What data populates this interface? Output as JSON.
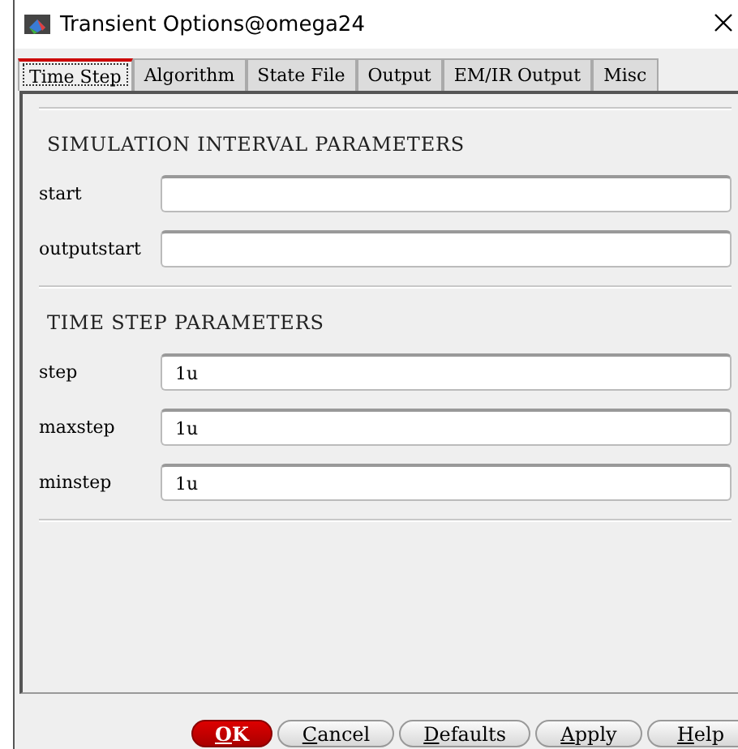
{
  "window": {
    "title": "Transient Options@omega24"
  },
  "tabs": [
    {
      "label": "Time Step",
      "selected": true
    },
    {
      "label": "Algorithm",
      "selected": false
    },
    {
      "label": "State File",
      "selected": false
    },
    {
      "label": "Output",
      "selected": false
    },
    {
      "label": "EM/IR Output",
      "selected": false
    },
    {
      "label": "Misc",
      "selected": false
    }
  ],
  "sections": [
    {
      "heading": "SIMULATION INTERVAL PARAMETERS",
      "fields": [
        {
          "label": "start"
        },
        {
          "label": "outputstart"
        }
      ]
    },
    {
      "heading": "TIME STEP PARAMETERS",
      "fields": [
        {
          "label": "step",
          "value": "1u"
        },
        {
          "label": "maxstep",
          "value": "1u"
        },
        {
          "label": "minstep",
          "value": "1u"
        }
      ]
    }
  ],
  "buttons": [
    {
      "label": "OK",
      "kind": "default"
    },
    {
      "label": "Cancel",
      "kind": "normal"
    },
    {
      "label": "Defaults",
      "kind": "normal"
    },
    {
      "label": "Apply",
      "kind": "normal"
    },
    {
      "label": "Help",
      "kind": "normal"
    }
  ]
}
